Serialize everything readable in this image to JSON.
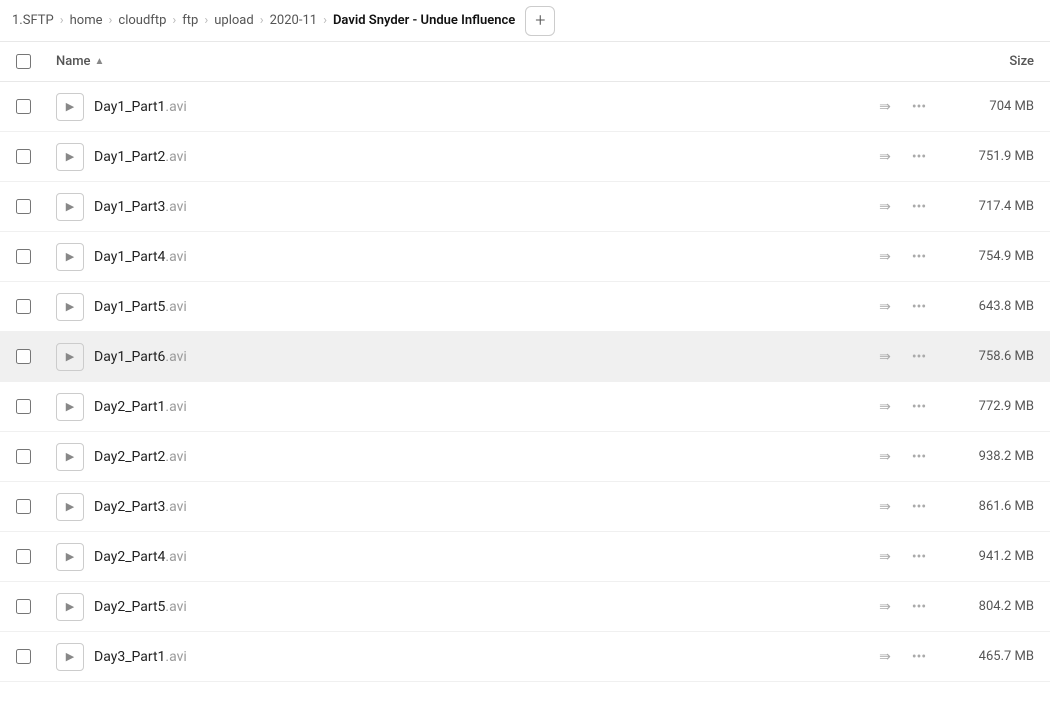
{
  "breadcrumb": {
    "items": [
      {
        "label": "1.SFTP",
        "active": false
      },
      {
        "label": "home",
        "active": false
      },
      {
        "label": "cloudftp",
        "active": false
      },
      {
        "label": "ftp",
        "active": false
      },
      {
        "label": "upload",
        "active": false
      },
      {
        "label": "2020-11",
        "active": false
      },
      {
        "label": "David Snyder - Undue Influence",
        "active": true
      }
    ],
    "add_button_label": "+"
  },
  "table": {
    "columns": {
      "name_label": "Name",
      "sort_indicator": "▲",
      "size_label": "Size"
    },
    "files": [
      {
        "id": 1,
        "name": "Day1_Part1",
        "ext": ".avi",
        "size": "704 MB",
        "highlighted": false
      },
      {
        "id": 2,
        "name": "Day1_Part2",
        "ext": ".avi",
        "size": "751.9 MB",
        "highlighted": false
      },
      {
        "id": 3,
        "name": "Day1_Part3",
        "ext": ".avi",
        "size": "717.4 MB",
        "highlighted": false
      },
      {
        "id": 4,
        "name": "Day1_Part4",
        "ext": ".avi",
        "size": "754.9 MB",
        "highlighted": false
      },
      {
        "id": 5,
        "name": "Day1_Part5",
        "ext": ".avi",
        "size": "643.8 MB",
        "highlighted": false
      },
      {
        "id": 6,
        "name": "Day1_Part6",
        "ext": ".avi",
        "size": "758.6 MB",
        "highlighted": true
      },
      {
        "id": 7,
        "name": "Day2_Part1",
        "ext": ".avi",
        "size": "772.9 MB",
        "highlighted": false
      },
      {
        "id": 8,
        "name": "Day2_Part2",
        "ext": ".avi",
        "size": "938.2 MB",
        "highlighted": false
      },
      {
        "id": 9,
        "name": "Day2_Part3",
        "ext": ".avi",
        "size": "861.6 MB",
        "highlighted": false
      },
      {
        "id": 10,
        "name": "Day2_Part4",
        "ext": ".avi",
        "size": "941.2 MB",
        "highlighted": false
      },
      {
        "id": 11,
        "name": "Day2_Part5",
        "ext": ".avi",
        "size": "804.2 MB",
        "highlighted": false
      },
      {
        "id": 12,
        "name": "Day3_Part1",
        "ext": ".avi",
        "size": "465.7 MB",
        "highlighted": false
      }
    ]
  },
  "icons": {
    "play": "▶",
    "share": "⇉",
    "more": "···",
    "sort_asc": "▲",
    "chevron_right": "›",
    "plus": "+"
  }
}
